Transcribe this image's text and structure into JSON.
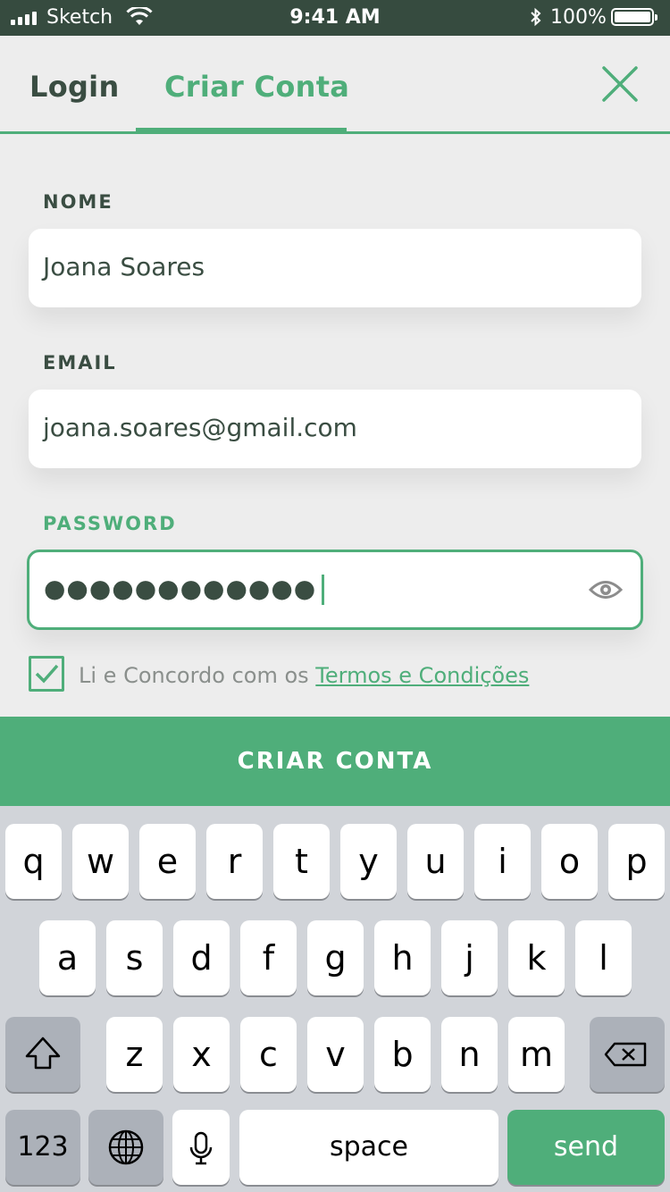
{
  "status_bar": {
    "carrier": "Sketch",
    "time": "9:41 AM",
    "battery": "100%"
  },
  "tabs": [
    {
      "label": "Login",
      "active": false
    },
    {
      "label": "Criar Conta",
      "active": true
    }
  ],
  "form": {
    "name_label": "NOME",
    "name_value": "Joana Soares",
    "email_label": "EMAIL",
    "email_value": "joana.soares@gmail.com",
    "password_label": "PASSWORD",
    "password_value": "●●●●●●●●●●●●",
    "terms_checked": true,
    "terms_prefix": "Li e Concordo com os ",
    "terms_link": "Termos e Condições",
    "submit_label": "CRIAR CONTA"
  },
  "keyboard": {
    "row1": [
      "q",
      "w",
      "e",
      "r",
      "t",
      "y",
      "u",
      "i",
      "o",
      "p"
    ],
    "row2": [
      "a",
      "s",
      "d",
      "f",
      "g",
      "h",
      "j",
      "k",
      "l"
    ],
    "row3": [
      "z",
      "x",
      "c",
      "v",
      "b",
      "n",
      "m"
    ],
    "numbers_key": "123",
    "space_key": "space",
    "send_key": "send"
  },
  "colors": {
    "accent": "#4fae7a",
    "status_bar_bg": "#364b3f",
    "text_dark": "#3a4d42"
  }
}
